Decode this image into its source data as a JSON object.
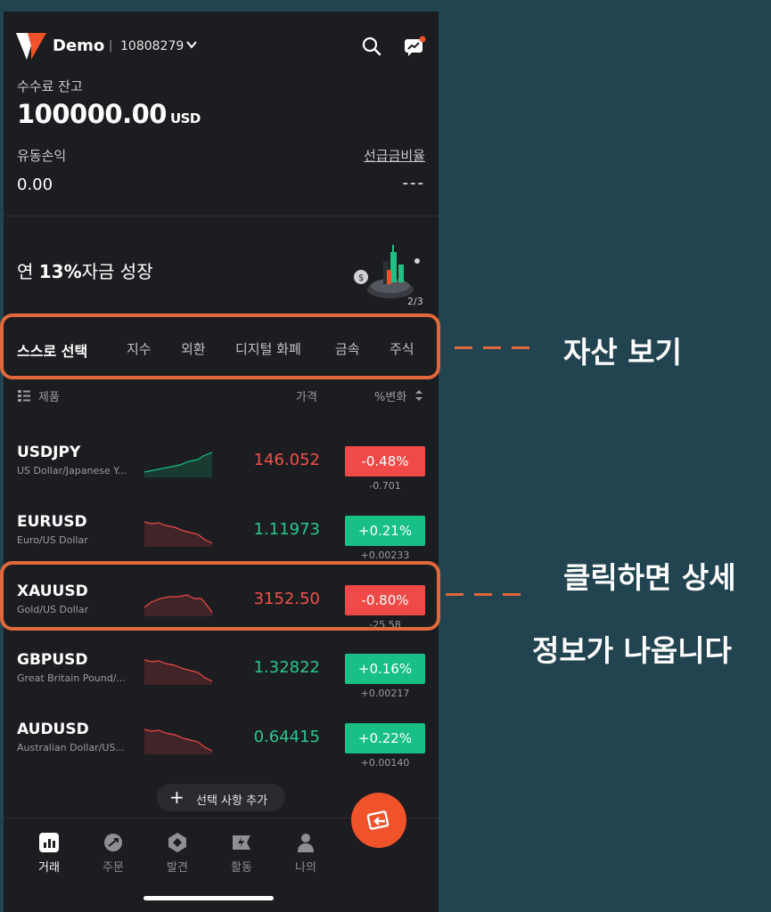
{
  "header": {
    "account_name": "Demo",
    "separator": "|",
    "account_id": "10808279"
  },
  "balance": {
    "label": "수수료 잔고",
    "value": "100000.00",
    "currency": "USD"
  },
  "floating_pl": {
    "label": "유동손익",
    "value": "0.00"
  },
  "margin_ratio": {
    "label": "선급금비율",
    "value": "---"
  },
  "promo": {
    "prefix": "연 ",
    "bold": "13%",
    "suffix": "자금 성장",
    "page": "2/3"
  },
  "tabs": [
    {
      "label": "스스로 선택",
      "active": true
    },
    {
      "label": "지수"
    },
    {
      "label": "외환"
    },
    {
      "label": "디지털 화폐"
    },
    {
      "label": "금속"
    },
    {
      "label": "주식"
    }
  ],
  "table_header": {
    "product": "제품",
    "price": "가격",
    "change": "%변화"
  },
  "instruments": [
    {
      "symbol": "USDJPY",
      "desc": "US Dollar/Japanese Y...",
      "price": "146.052",
      "direction": "down",
      "change_pct": "-0.48%",
      "change_abs": "-0.701",
      "spark_trend": "up"
    },
    {
      "symbol": "EURUSD",
      "desc": "Euro/US Dollar",
      "price": "1.11973",
      "direction": "up",
      "change_pct": "+0.21%",
      "change_abs": "+0.00233",
      "spark_trend": "down"
    },
    {
      "symbol": "XAUUSD",
      "desc": "Gold/US Dollar",
      "price": "3152.50",
      "direction": "down",
      "change_pct": "-0.80%",
      "change_abs": "-25.58",
      "spark_trend": "hump"
    },
    {
      "symbol": "GBPUSD",
      "desc": "Great Britain Pound/...",
      "price": "1.32822",
      "direction": "up",
      "change_pct": "+0.16%",
      "change_abs": "+0.00217",
      "spark_trend": "down"
    },
    {
      "symbol": "AUDUSD",
      "desc": "Australian Dollar/US...",
      "price": "0.64415",
      "direction": "up",
      "change_pct": "+0.22%",
      "change_abs": "+0.00140",
      "spark_trend": "down"
    }
  ],
  "add_selection": "선택 사항 추가",
  "nav": [
    {
      "label": "거래",
      "icon": "bar-chart-icon",
      "active": true
    },
    {
      "label": "주문",
      "icon": "order-icon"
    },
    {
      "label": "발견",
      "icon": "discover-icon"
    },
    {
      "label": "활동",
      "icon": "activity-icon"
    },
    {
      "label": "나의",
      "icon": "user-icon"
    }
  ],
  "annotations": {
    "asset_view": "자산 보기",
    "detail_line1": "클릭하면 상세",
    "detail_line2": "정보가 나옵니다"
  },
  "colors": {
    "background": "#224451",
    "app_bg": "#1c1d20",
    "up": "#18c085",
    "down": "#ef4a48",
    "highlight": "#e0683a",
    "fab": "#f0522a"
  }
}
